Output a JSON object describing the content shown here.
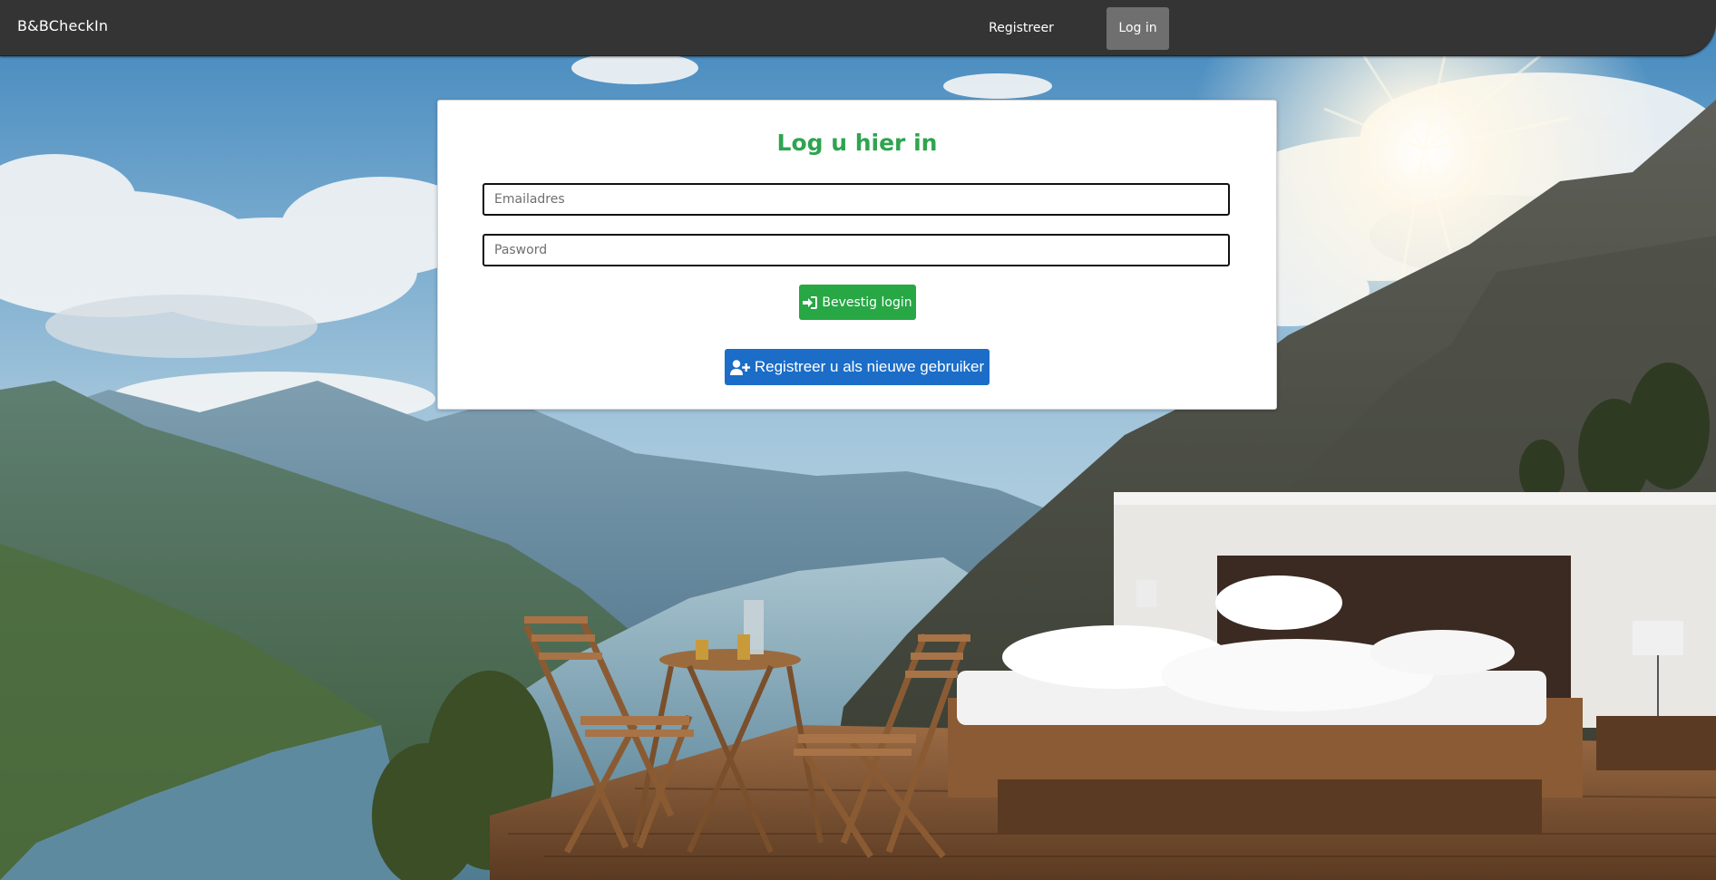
{
  "navbar": {
    "brand": "B&BCheckIn",
    "links": [
      {
        "label": "Registreer"
      },
      {
        "label": "Log in"
      }
    ]
  },
  "login_card": {
    "title": "Log u hier in",
    "email_placeholder": "Emailadres",
    "password_placeholder": "Pasword",
    "confirm_button": {
      "label": "Bevestig login",
      "icon": "sign-in-icon"
    },
    "register_button": {
      "label": "Registreer u als nieuwe gebruiker",
      "icon": "user-plus-icon"
    }
  },
  "colors": {
    "navbar_bg": "#343434",
    "active_nav_bg": "#6f6f6f",
    "title_green": "#2ea44f",
    "confirm_green": "#28a745",
    "register_blue": "#1b6dc7"
  }
}
